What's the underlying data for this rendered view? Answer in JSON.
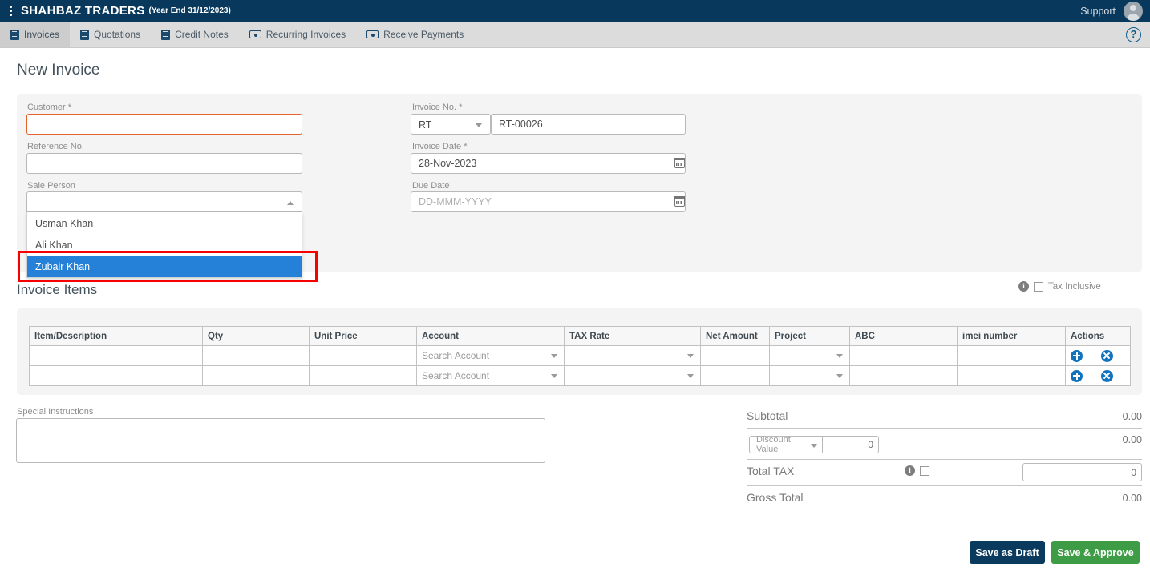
{
  "topbar": {
    "menu_icon": "kebab-menu-icon",
    "company": "SHAHBAZ TRADERS",
    "year_end": "(Year End 31/12/2023)",
    "support": "Support",
    "avatar_icon": "user-avatar-icon"
  },
  "tabs": [
    {
      "label": "Invoices",
      "icon": "document-icon",
      "active": true
    },
    {
      "label": "Quotations",
      "icon": "document-icon",
      "active": false
    },
    {
      "label": "Credit Notes",
      "icon": "document-icon",
      "active": false
    },
    {
      "label": "Recurring Invoices",
      "icon": "cash-note-icon",
      "active": false
    },
    {
      "label": "Receive Payments",
      "icon": "cash-note-icon",
      "active": false
    }
  ],
  "help_icon": "question-mark-help-icon",
  "page": {
    "title": "New Invoice"
  },
  "form": {
    "customer": {
      "label": "Customer *",
      "value": "",
      "placeholder": ""
    },
    "reference_no": {
      "label": "Reference No.",
      "value": "",
      "placeholder": ""
    },
    "sale_person": {
      "label": "Sale Person",
      "value": "",
      "placeholder": "",
      "expanded": true,
      "options": [
        "Usman Khan",
        "Ali Khan",
        "Zubair Khan"
      ],
      "highlighted": "Zubair Khan"
    },
    "invoice_no": {
      "label": "Invoice No. *",
      "prefix": "RT",
      "value": "RT-00026"
    },
    "invoice_date": {
      "label": "Invoice Date *",
      "value": "28-Nov-2023",
      "placeholder": "DD-MMM-YYYY"
    },
    "due_date": {
      "label": "Due Date",
      "value": "",
      "placeholder": "DD-MMM-YYYY"
    }
  },
  "items_section": {
    "title": "Invoice Items",
    "tax_inclusive": {
      "label": "Tax Inclusive",
      "checked": false,
      "info_icon": "info-icon"
    },
    "columns": [
      "Item/Description",
      "Qty",
      "Unit Price",
      "Account",
      "TAX Rate",
      "Net Amount",
      "Project",
      "ABC",
      "imei number",
      "Actions"
    ],
    "rows": [
      {
        "item": "",
        "qty": "",
        "unit_price": "",
        "account": "Search Account",
        "tax_rate": "",
        "net_amount": "",
        "project": "",
        "abc": "",
        "imei": "",
        "actions": [
          "add-row-button",
          "delete-row-button"
        ]
      },
      {
        "item": "",
        "qty": "",
        "unit_price": "",
        "account": "Search Account",
        "tax_rate": "",
        "net_amount": "",
        "project": "",
        "abc": "",
        "imei": "",
        "actions": [
          "add-row-button",
          "delete-row-button"
        ]
      }
    ]
  },
  "special_instructions": {
    "label": "Special Instructions",
    "value": "",
    "placeholder": ""
  },
  "totals": {
    "subtotal": {
      "label": "Subtotal",
      "value": "0.00"
    },
    "discount": {
      "type_label": "Discount Value",
      "input_value": "0",
      "amount": "0.00"
    },
    "total_tax": {
      "label": "Total TAX",
      "checked": false,
      "info_icon": "info-icon",
      "input_value": "0"
    },
    "gross_total": {
      "label": "Gross Total",
      "value": "0.00"
    }
  },
  "actions": {
    "save_draft": "Save as Draft",
    "save_approve": "Save & Approve"
  },
  "colors": {
    "topbar": "#08385c",
    "tabbar": "#dcdcdc",
    "accent_blue": "#2481d7",
    "error_border": "#e4622c",
    "annotation_red": "#f60000",
    "draft_button": "#0a3a5e",
    "approve_button": "#3d9c45"
  }
}
